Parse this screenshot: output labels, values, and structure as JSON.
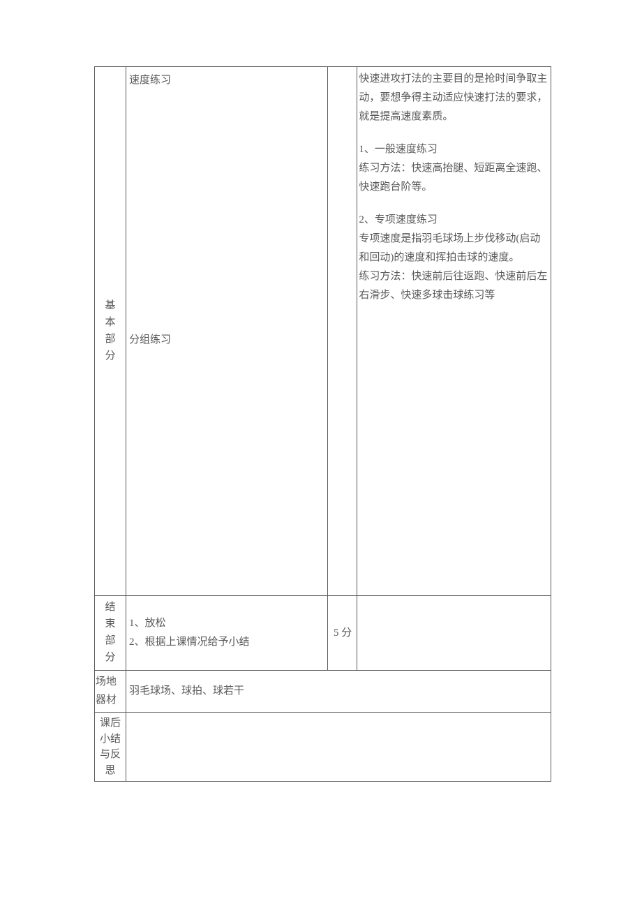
{
  "sections": {
    "basic": {
      "label": "基本部分",
      "content_1": "速度练习",
      "content_2": "分组练习",
      "detail_intro": "快速进攻打法的主要目的是抢时间争取主动，要想争得主动适应快速打法的要求，就是提高速度素质。",
      "detail_1_title": "1、一般速度练习",
      "detail_1_body": "练习方法：快速高抬腿、短距离全速跑、快速跑台阶等。",
      "detail_2_title": "2、专项速度练习",
      "detail_2_body1": "专项速度是指羽毛球场上步伐移动(启动和回动)的速度和挥拍击球的速度。",
      "detail_2_body2": "练习方法：快速前后往返跑、快速前后左右滑步、快速多球击球练习等"
    },
    "end": {
      "label": "结束部分",
      "content_line1": "1、放松",
      "content_line2": "2、根据上课情况给予小结",
      "time": "5 分"
    },
    "equip": {
      "label": "场地器材",
      "content": "羽毛球场、球拍、球若干"
    },
    "review": {
      "label": "课后小结与反思"
    }
  }
}
